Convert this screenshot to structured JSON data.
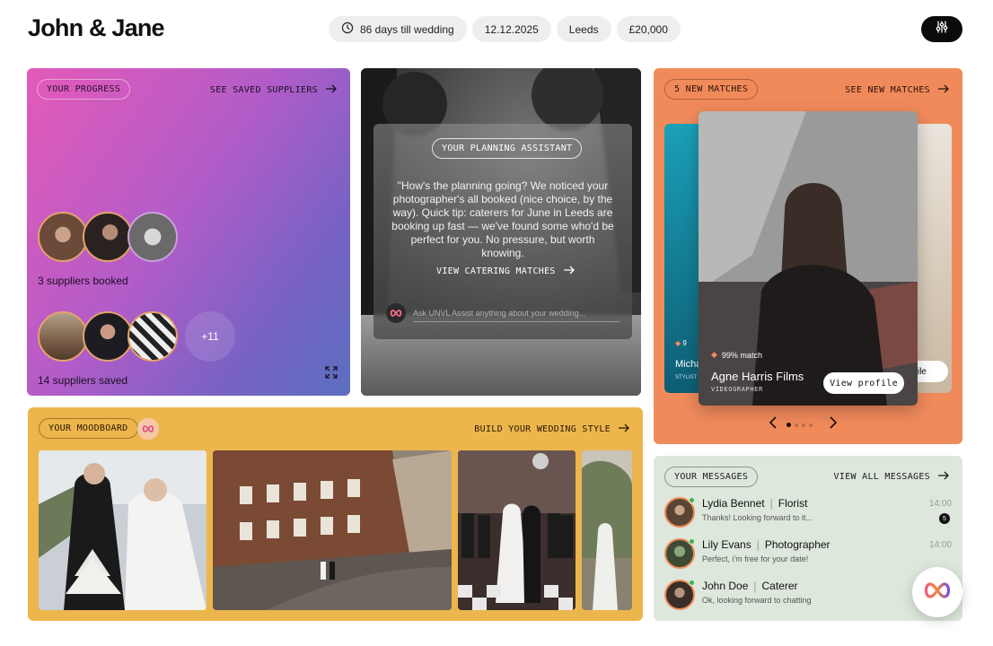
{
  "header": {
    "title": "John & Jane",
    "chips": {
      "countdown": "86 days till wedding",
      "date": "12.12.2025",
      "location": "Leeds",
      "budget": "£20,000"
    },
    "icons": {
      "countdown": "timer-icon",
      "filter": "sliders-icon"
    }
  },
  "progress": {
    "pill": "YOUR PROGRESS",
    "link": "SEE SAVED SUPPLIERS",
    "booked_caption": "3 suppliers booked",
    "saved_caption": "14 suppliers saved",
    "more_count": "+11",
    "icon": "expand-icon"
  },
  "assistant": {
    "pill": "YOUR PLANNING ASSISTANT",
    "quote": "\"How's the planning going? We noticed your photographer's all booked (nice choice, by the way). Quick tip: caterers for June in Leeds are booking up fast — we've found some who'd be perfect for you. No pressure, but worth knowing.",
    "link": "VIEW CATERING MATCHES",
    "input_placeholder": "Ask UNVL Assist anything about your wedding..."
  },
  "matches": {
    "pill": "5 NEW MATCHES",
    "link": "SEE NEW MATCHES",
    "left_card": {
      "name": "Micha",
      "role": "STYLIST",
      "match": "9"
    },
    "main_card": {
      "match": "99% match",
      "name": "Agne Harris Films",
      "role": "VIDEOGRAPHER",
      "button": "View profile"
    },
    "right_card": {
      "button": "ile"
    },
    "active_page": 1,
    "pages": 4
  },
  "moodboard": {
    "pill": "YOUR MOODBOARD",
    "link": "BUILD YOUR WEDDING STYLE"
  },
  "messages": {
    "pill": "YOUR MESSAGES",
    "link": "VIEW ALL MESSAGES",
    "items": [
      {
        "name": "Lydia Bennet",
        "role": "Florist",
        "text": "Thanks! Looking forward to it...",
        "time": "14:00",
        "unread": "5"
      },
      {
        "name": "Lily Evans",
        "role": "Photographer",
        "text": "Perfect, i'm free for your date!",
        "time": "14:00"
      },
      {
        "name": "John Doe",
        "role": "Caterer",
        "text": "Ok, looking forward to chatting"
      }
    ]
  },
  "colors": {
    "progress_gradient": [
      "#e45ab8",
      "#5b6fc0"
    ],
    "matches": "#f08a5b",
    "moodboard": "#ecb64d",
    "messages": "#dde7dc",
    "brand_gradient": [
      "#f25a7a",
      "#7a4ce0"
    ]
  }
}
